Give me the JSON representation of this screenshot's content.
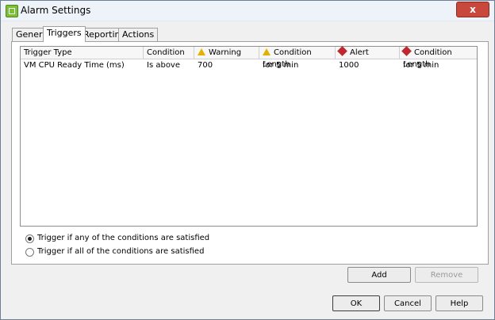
{
  "window": {
    "title": "Alarm Settings",
    "close_label": "x"
  },
  "tabs": [
    {
      "label": "General"
    },
    {
      "label": "Triggers"
    },
    {
      "label": "Reporting"
    },
    {
      "label": "Actions"
    }
  ],
  "table": {
    "columns": [
      {
        "label": "Trigger Type"
      },
      {
        "label": "Condition"
      },
      {
        "label": "Warning",
        "icon": "warning-icon"
      },
      {
        "label": "Condition Length",
        "icon": "warning-icon"
      },
      {
        "label": "Alert",
        "icon": "alert-icon"
      },
      {
        "label": "Condition Length",
        "icon": "alert-icon"
      }
    ],
    "rows": [
      {
        "cells": [
          "VM CPU Ready Time (ms)",
          "Is above",
          "700",
          "for 5 min",
          "1000",
          "for 5 min"
        ]
      }
    ]
  },
  "trigger_options": [
    {
      "label": "Trigger if any of the conditions are satisfied",
      "checked": true
    },
    {
      "label": "Trigger if all of the conditions are satisfied",
      "checked": false
    }
  ],
  "buttons": {
    "add": "Add",
    "remove": "Remove",
    "ok": "OK",
    "cancel": "Cancel",
    "help": "Help"
  }
}
